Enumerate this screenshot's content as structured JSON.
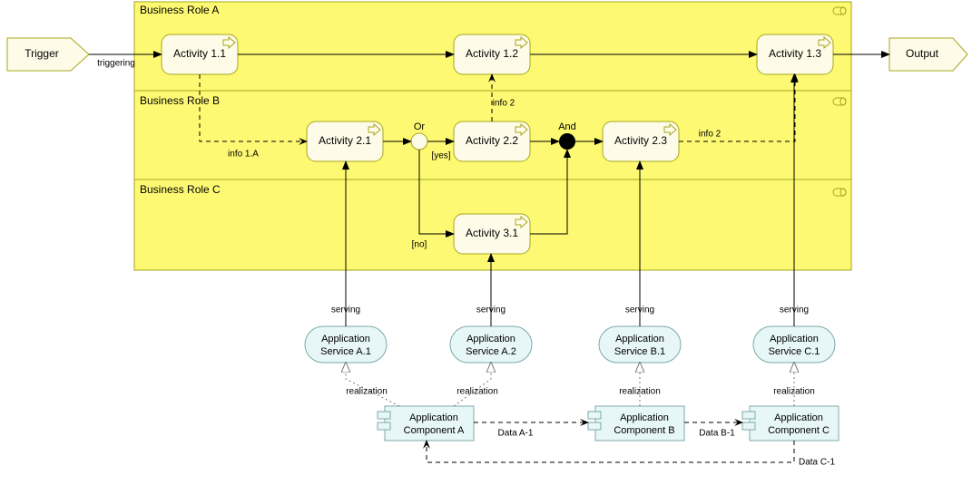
{
  "lanes": {
    "a": {
      "label": "Business Role A"
    },
    "b": {
      "label": "Business Role B"
    },
    "c": {
      "label": "Business Role C"
    }
  },
  "events": {
    "trigger": "Trigger",
    "output": "Output"
  },
  "activities": {
    "a11": "Activity 1.1",
    "a12": "Activity 1.2",
    "a13": "Activity 1.3",
    "a21": "Activity 2.1",
    "a22": "Activity 2.2",
    "a23": "Activity 2.3",
    "a31": "Activity 3.1"
  },
  "junctions": {
    "or": "Or",
    "and": "And"
  },
  "edgeLabels": {
    "triggering": "triggering",
    "info1a": "info 1.A",
    "info2_up": "info 2",
    "info2_side": "info 2",
    "yes": "[yes]",
    "no": "[no]"
  },
  "services": {
    "a1": "Application Service A.1",
    "a2": "Application Service A.2",
    "b1": "Application Service B.1",
    "c1": "Application Service C.1"
  },
  "serving": {
    "a1": "serving",
    "a2": "serving",
    "b1": "serving",
    "c1": "serving"
  },
  "realization": {
    "a1": "realization",
    "a2": "realization",
    "b1": "realization",
    "c1": "realization"
  },
  "components": {
    "a": "Application Component A",
    "b": "Application Component B",
    "c": "Application Component C"
  },
  "dataFlows": {
    "ab": "Data A-1",
    "bc": "Data B-1",
    "ca": "Data C-1"
  },
  "chart_data": {
    "type": "diagram",
    "notation": "ArchiMate",
    "business_roles": [
      {
        "id": "RoleA",
        "name": "Business Role A",
        "activities": [
          "Activity 1.1",
          "Activity 1.2",
          "Activity 1.3"
        ]
      },
      {
        "id": "RoleB",
        "name": "Business Role B",
        "activities": [
          "Activity 2.1",
          "Activity 2.2",
          "Activity 2.3"
        ],
        "junctions": [
          "Or",
          "And"
        ]
      },
      {
        "id": "RoleC",
        "name": "Business Role C",
        "activities": [
          "Activity 3.1"
        ]
      }
    ],
    "business_events": [
      "Trigger",
      "Output"
    ],
    "flows": [
      {
        "from": "Trigger",
        "to": "Activity 1.1",
        "type": "triggering",
        "label": "triggering"
      },
      {
        "from": "Activity 1.1",
        "to": "Activity 1.2",
        "type": "triggering"
      },
      {
        "from": "Activity 1.2",
        "to": "Activity 1.3",
        "type": "triggering"
      },
      {
        "from": "Activity 1.3",
        "to": "Output",
        "type": "triggering"
      },
      {
        "from": "Activity 1.1",
        "to": "Activity 2.1",
        "type": "flow",
        "label": "info 1.A"
      },
      {
        "from": "Activity 2.1",
        "to": "Or",
        "type": "triggering"
      },
      {
        "from": "Or",
        "to": "Activity 2.2",
        "type": "triggering",
        "label": "[yes]"
      },
      {
        "from": "Or",
        "to": "Activity 3.1",
        "type": "triggering",
        "label": "[no]"
      },
      {
        "from": "Activity 2.2",
        "to": "Activity 1.2",
        "type": "flow",
        "label": "info 2"
      },
      {
        "from": "Activity 2.2",
        "to": "And",
        "type": "triggering"
      },
      {
        "from": "Activity 3.1",
        "to": "And",
        "type": "triggering"
      },
      {
        "from": "And",
        "to": "Activity 2.3",
        "type": "triggering"
      },
      {
        "from": "Activity 2.3",
        "to": "Activity 1.3",
        "type": "flow",
        "label": "info 2"
      }
    ],
    "application_services": [
      "Application Service A.1",
      "Application Service A.2",
      "Application Service B.1",
      "Application Service C.1"
    ],
    "application_components": [
      "Application Component A",
      "Application Component B",
      "Application Component C"
    ],
    "serving": [
      {
        "from": "Application Service A.1",
        "to": "Activity 2.1"
      },
      {
        "from": "Application Service A.2",
        "to": "Activity 3.1"
      },
      {
        "from": "Application Service B.1",
        "to": "Activity 2.3"
      },
      {
        "from": "Application Service C.1",
        "to": "Activity 1.3"
      }
    ],
    "realization_rels": [
      {
        "from": "Application Component A",
        "to": "Application Service A.1"
      },
      {
        "from": "Application Component A",
        "to": "Application Service A.2"
      },
      {
        "from": "Application Component B",
        "to": "Application Service B.1"
      },
      {
        "from": "Application Component C",
        "to": "Application Service C.1"
      }
    ],
    "data_flows": [
      {
        "from": "Application Component A",
        "to": "Application Component B",
        "label": "Data A-1"
      },
      {
        "from": "Application Component B",
        "to": "Application Component C",
        "label": "Data B-1"
      },
      {
        "from": "Application Component C",
        "to": "Application Component A",
        "label": "Data C-1"
      }
    ]
  }
}
